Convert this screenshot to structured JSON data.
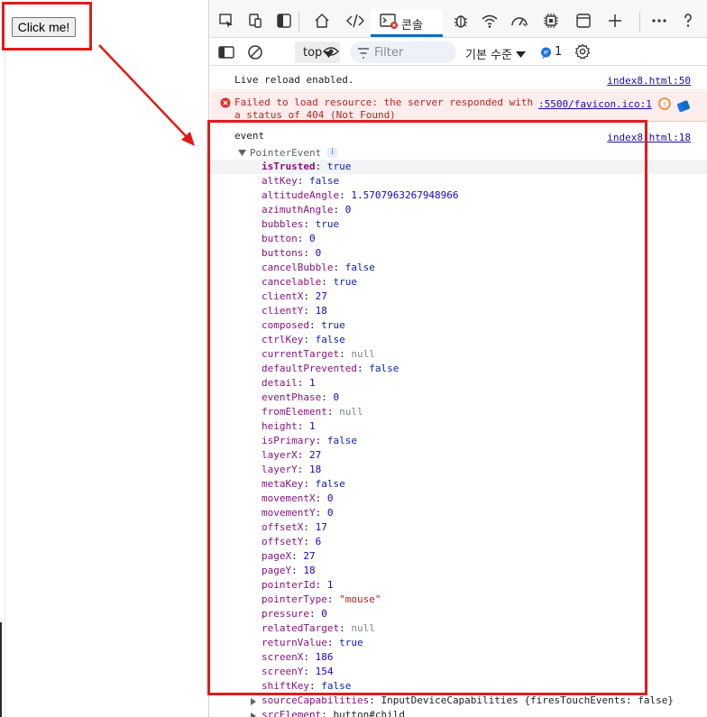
{
  "page": {
    "button_label": "Click me!"
  },
  "devtools": {
    "tabs": {
      "console_label": "콘솔"
    },
    "toolbar": {
      "context": "top",
      "filter_placeholder": "Filter",
      "level": "기본 수준",
      "issue_count": "1"
    },
    "messages": {
      "live_reload": {
        "text": "Live reload enabled.",
        "source": "index8.html:50"
      },
      "error": {
        "text": "Failed to load resource: the server responded with\na status of 404 (Not Found)",
        "source": ":5500/favicon.ico:1"
      },
      "event": {
        "text": "event",
        "source": "index8.html:18"
      }
    },
    "object": {
      "class_name": "PointerEvent",
      "info_badge": "i",
      "properties": [
        {
          "key": "isTrusted",
          "value": "true",
          "type": "bool",
          "highlight": true,
          "bold": true
        },
        {
          "key": "altKey",
          "value": "false",
          "type": "bool"
        },
        {
          "key": "altitudeAngle",
          "value": "1.5707963267948966",
          "type": "num"
        },
        {
          "key": "azimuthAngle",
          "value": "0",
          "type": "num"
        },
        {
          "key": "bubbles",
          "value": "true",
          "type": "bool"
        },
        {
          "key": "button",
          "value": "0",
          "type": "num"
        },
        {
          "key": "buttons",
          "value": "0",
          "type": "num"
        },
        {
          "key": "cancelBubble",
          "value": "false",
          "type": "bool"
        },
        {
          "key": "cancelable",
          "value": "true",
          "type": "bool"
        },
        {
          "key": "clientX",
          "value": "27",
          "type": "num"
        },
        {
          "key": "clientY",
          "value": "18",
          "type": "num"
        },
        {
          "key": "composed",
          "value": "true",
          "type": "bool"
        },
        {
          "key": "ctrlKey",
          "value": "false",
          "type": "bool"
        },
        {
          "key": "currentTarget",
          "value": "null",
          "type": "null"
        },
        {
          "key": "defaultPrevented",
          "value": "false",
          "type": "bool"
        },
        {
          "key": "detail",
          "value": "1",
          "type": "num"
        },
        {
          "key": "eventPhase",
          "value": "0",
          "type": "num"
        },
        {
          "key": "fromElement",
          "value": "null",
          "type": "null"
        },
        {
          "key": "height",
          "value": "1",
          "type": "num"
        },
        {
          "key": "isPrimary",
          "value": "false",
          "type": "bool"
        },
        {
          "key": "layerX",
          "value": "27",
          "type": "num"
        },
        {
          "key": "layerY",
          "value": "18",
          "type": "num"
        },
        {
          "key": "metaKey",
          "value": "false",
          "type": "bool"
        },
        {
          "key": "movementX",
          "value": "0",
          "type": "num"
        },
        {
          "key": "movementY",
          "value": "0",
          "type": "num"
        },
        {
          "key": "offsetX",
          "value": "17",
          "type": "num"
        },
        {
          "key": "offsetY",
          "value": "6",
          "type": "num"
        },
        {
          "key": "pageX",
          "value": "27",
          "type": "num"
        },
        {
          "key": "pageY",
          "value": "18",
          "type": "num"
        },
        {
          "key": "pointerId",
          "value": "1",
          "type": "num"
        },
        {
          "key": "pointerType",
          "value": "\"mouse\"",
          "type": "str"
        },
        {
          "key": "pressure",
          "value": "0",
          "type": "num"
        },
        {
          "key": "relatedTarget",
          "value": "null",
          "type": "null"
        },
        {
          "key": "returnValue",
          "value": "true",
          "type": "bool"
        },
        {
          "key": "screenX",
          "value": "186",
          "type": "num"
        },
        {
          "key": "screenY",
          "value": "154",
          "type": "num"
        },
        {
          "key": "shiftKey",
          "value": "false",
          "type": "bool"
        },
        {
          "key": "sourceCapabilities",
          "value": "InputDeviceCapabilities {firesTouchEvents: false}",
          "type": "obj",
          "expandable": true
        },
        {
          "key": "srcElement",
          "value": "button#child",
          "type": "obj",
          "expandable": true
        }
      ]
    }
  },
  "colors": {
    "annotation": "#e01b1b",
    "accent": "#0f6cbd",
    "error_bg": "#fdeded"
  }
}
